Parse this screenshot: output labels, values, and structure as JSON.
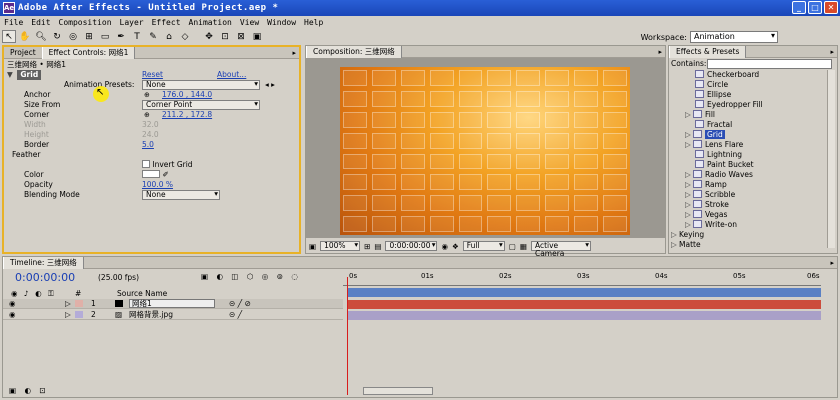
{
  "window": {
    "title": "Adobe After Effects - Untitled Project.aep *",
    "app_icon": "Ae"
  },
  "menu": [
    "File",
    "Edit",
    "Composition",
    "Layer",
    "Effect",
    "Animation",
    "View",
    "Window",
    "Help"
  ],
  "toolbar": {
    "workspace_label": "Workspace:",
    "workspace_value": "Animation"
  },
  "left_panel": {
    "tabs": [
      "Project",
      "Effect Controls: 网络1"
    ],
    "breadcrumb": "三维网络 • 网络1",
    "effect_name": "Grid",
    "reset": "Reset",
    "about": "About...",
    "presets_label": "Animation Presets:",
    "presets_value": "None",
    "params": [
      {
        "label": "Anchor",
        "value": "176.0 , 144.0"
      },
      {
        "label": "Size From",
        "value": "Corner Point"
      },
      {
        "label": "Corner",
        "value": "211.2 , 172.8"
      },
      {
        "label": "Width",
        "value": "32.0"
      },
      {
        "label": "Height",
        "value": "24.0"
      },
      {
        "label": "Border",
        "value": "5.0"
      },
      {
        "label": "Feather",
        "value": ""
      },
      {
        "label": "",
        "value": "Invert Grid"
      },
      {
        "label": "Color",
        "value": ""
      },
      {
        "label": "Opacity",
        "value": "100.0 %"
      },
      {
        "label": "Blending Mode",
        "value": "None"
      }
    ]
  },
  "comp_panel": {
    "tab": "Composition: 三维网络",
    "zoom": "100%",
    "timecode": "0:00:00:00",
    "resolution": "Full",
    "camera": "Active Camera"
  },
  "effects_panel": {
    "tab": "Effects & Presets",
    "contains_label": "Contains:",
    "items": [
      "Checkerboard",
      "Circle",
      "Ellipse",
      "Eyedropper Fill",
      "Fill",
      "Fractal",
      "Grid",
      "Lens Flare",
      "Lightning",
      "Paint Bucket",
      "Radio Waves",
      "Ramp",
      "Scribble",
      "Stroke",
      "Vegas",
      "Write-on"
    ],
    "categories": [
      "Keying",
      "Matte"
    ]
  },
  "timeline": {
    "tab": "Timeline: 三维网络",
    "timecode": "0:00:00:00",
    "fps": "(25.00 fps)",
    "col_num": "#",
    "col_source": "Source Name",
    "ruler": [
      "0s",
      "01s",
      "02s",
      "03s",
      "04s",
      "05s",
      "06s"
    ],
    "layers": [
      {
        "num": "1",
        "name": "网络1",
        "color": "#c0392b"
      },
      {
        "num": "2",
        "name": "网格背景.jpg",
        "color": "#8e86b4"
      }
    ]
  },
  "colors": {
    "accent": "#e8b228",
    "title_bar": "#1f4fc4",
    "layer1_bar": "#cc4c3c",
    "layer2_bar": "#a9a0c8",
    "playhead": "#d81c1c"
  }
}
